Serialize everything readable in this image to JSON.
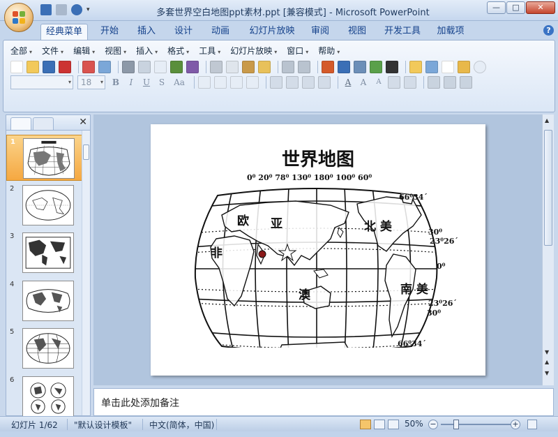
{
  "window": {
    "title": "多套世界空白地图ppt素材.ppt [兼容模式] - Microsoft PowerPoint",
    "minimize_label": "—",
    "maximize_label": "□",
    "close_label": "✕"
  },
  "ribbon_tabs": [
    "经典菜单",
    "开始",
    "插入",
    "设计",
    "动画",
    "幻灯片放映",
    "审阅",
    "视图",
    "开发工具",
    "加载项"
  ],
  "active_tab": "经典菜单",
  "classic_menu": [
    "全部",
    "文件",
    "编辑",
    "视图",
    "插入",
    "格式",
    "工具",
    "幻灯片放映",
    "窗口",
    "帮助"
  ],
  "font_size_value": "18",
  "help_label": "?",
  "slide_panel": {
    "close_label": "✕",
    "thumbnails": [
      {
        "num": "1",
        "selected": true
      },
      {
        "num": "2",
        "selected": false
      },
      {
        "num": "3",
        "selected": false
      },
      {
        "num": "4",
        "selected": false
      },
      {
        "num": "5",
        "selected": false
      },
      {
        "num": "6",
        "selected": false
      }
    ]
  },
  "slide": {
    "title": "世界地图",
    "top_longitudes": "0⁰ 20⁰  78⁰  130⁰ 180⁰   100⁰  60⁰",
    "continents": {
      "europe": "欧",
      "asia": "亚",
      "africa": "非",
      "north_america": "北  美",
      "oceania": "澳",
      "south_america": "南  美"
    },
    "latitudes": {
      "n66": "66⁰34´",
      "n30": "30⁰",
      "n23": "23⁰26´",
      "eq": "0⁰",
      "s23": "23⁰26´",
      "s30": "30⁰",
      "s66": "66⁰34´"
    }
  },
  "notes_placeholder": "单击此处添加备注",
  "status": {
    "slide_count": "幻灯片 1/62",
    "theme": "\"默认设计模板\"",
    "language": "中文(简体，中国)",
    "zoom": "50%"
  }
}
